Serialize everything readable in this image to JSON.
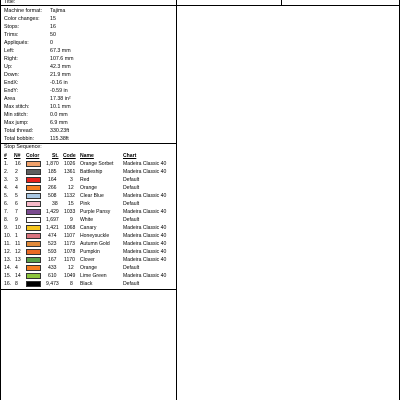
{
  "header": {
    "title_label": "Title:"
  },
  "machine": {
    "label": "Machine format:",
    "value": "Tajima"
  },
  "stats": [
    {
      "label": "Color changes:",
      "value": "15"
    },
    {
      "label": "Stops:",
      "value": "16"
    },
    {
      "label": "Trims:",
      "value": "50"
    },
    {
      "label": "Appliqués:",
      "value": "0"
    },
    {
      "label": "Left:",
      "value": "67.3 mm"
    },
    {
      "label": "Right:",
      "value": "107.6 mm"
    },
    {
      "label": "Up:",
      "value": "42.3 mm"
    },
    {
      "label": "Down:",
      "value": "21.9 mm"
    },
    {
      "label": "EndX:",
      "value": "-0.16 in"
    },
    {
      "label": "EndY:",
      "value": "-0.59 in"
    },
    {
      "label": "Area",
      "value": "17.38 in²"
    },
    {
      "label": "Max stitch:",
      "value": "10.1 mm"
    },
    {
      "label": "Min stitch:",
      "value": "0.0 mm"
    },
    {
      "label": "Max jump:",
      "value": "6.9 mm"
    },
    {
      "label": "Total thread:",
      "value": "330.23ft"
    },
    {
      "label": "Total bobbin:",
      "value": "115.38ft"
    }
  ],
  "stop_sequence": {
    "label": "Stop Sequence:",
    "headers": {
      "num": "#",
      "n": "N#",
      "color": "Color",
      "st": "St.",
      "code": "Code",
      "name": "Name",
      "chart": "Chart"
    },
    "rows": [
      {
        "num": "1.",
        "n": "16",
        "color": "#F0A16B",
        "st": "1,870",
        "code": "1026",
        "name": "Orange Sorbet",
        "chart": "Madeira Classic 40"
      },
      {
        "num": "2.",
        "n": "2",
        "color": "#5E5E5E",
        "st": "185",
        "code": "1361",
        "name": "Battleship",
        "chart": "Madeira Classic 40"
      },
      {
        "num": "3.",
        "n": "3",
        "color": "#E8201C",
        "st": "164",
        "code": "3",
        "name": "Red",
        "chart": "Default"
      },
      {
        "num": "4.",
        "n": "4",
        "color": "#F57D22",
        "st": "266",
        "code": "12",
        "name": "Orange",
        "chart": "Default"
      },
      {
        "num": "5.",
        "n": "5",
        "color": "#A9C7E3",
        "st": "508",
        "code": "1132",
        "name": "Clear Blue",
        "chart": "Madeira Classic 40"
      },
      {
        "num": "6.",
        "n": "6",
        "color": "#F7B9C9",
        "st": "38",
        "code": "15",
        "name": "Pink",
        "chart": "Default"
      },
      {
        "num": "7.",
        "n": "7",
        "color": "#7A4B8F",
        "st": "1,429",
        "code": "1033",
        "name": "Purple Pansy",
        "chart": "Madeira Classic 40"
      },
      {
        "num": "8.",
        "n": "9",
        "color": "#FFFFFF",
        "st": "1,697",
        "code": "9",
        "name": "White",
        "chart": "Default"
      },
      {
        "num": "9.",
        "n": "10",
        "color": "#F6C51C",
        "st": "1,421",
        "code": "1068",
        "name": "Canary",
        "chart": "Madeira Classic 40"
      },
      {
        "num": "10.",
        "n": "1",
        "color": "#D9747E",
        "st": "474",
        "code": "1107",
        "name": "Honeysuckle",
        "chart": "Madeira Classic 40"
      },
      {
        "num": "11.",
        "n": "11",
        "color": "#E0893A",
        "st": "523",
        "code": "1173",
        "name": "Autumn Gold",
        "chart": "Madeira Classic 40"
      },
      {
        "num": "12.",
        "n": "12",
        "color": "#EA6A25",
        "st": "593",
        "code": "1078",
        "name": "Pumpkin",
        "chart": "Madeira Classic 40"
      },
      {
        "num": "13.",
        "n": "13",
        "color": "#58A04A",
        "st": "167",
        "code": "1170",
        "name": "Clover",
        "chart": "Madeira Classic 40"
      },
      {
        "num": "14.",
        "n": "4",
        "color": "#F57D22",
        "st": "433",
        "code": "12",
        "name": "Orange",
        "chart": "Default"
      },
      {
        "num": "15.",
        "n": "14",
        "color": "#8CC43C",
        "st": "610",
        "code": "1049",
        "name": "Lime Green",
        "chart": "Madeira Classic 40"
      },
      {
        "num": "16.",
        "n": "8",
        "color": "#000000",
        "st": "9,473",
        "code": "8",
        "name": "Black",
        "chart": "Default"
      }
    ]
  }
}
